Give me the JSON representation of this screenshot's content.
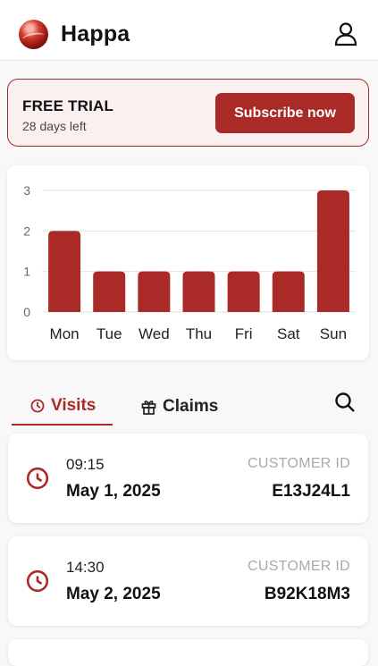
{
  "header": {
    "app_title": "Happa",
    "logo_icon": "happa-logo-icon",
    "profile_icon": "user-profile-icon"
  },
  "trial": {
    "title": "FREE TRIAL",
    "days_left": "28 days left",
    "subscribe_label": "Subscribe now"
  },
  "chart_data": {
    "type": "bar",
    "categories": [
      "Mon",
      "Tue",
      "Wed",
      "Thu",
      "Fri",
      "Sat",
      "Sun"
    ],
    "values": [
      2,
      1,
      1,
      1,
      1,
      1,
      3
    ],
    "ylim": [
      0,
      3
    ],
    "yticks": [
      0,
      1,
      2,
      3
    ],
    "grid": true,
    "bar_color": "#aa2a28"
  },
  "tabs": [
    {
      "label": "Visits",
      "icon": "clock-icon",
      "active": true
    },
    {
      "label": "Claims",
      "icon": "gift-icon",
      "active": false
    }
  ],
  "search_icon": "search-icon",
  "visits": [
    {
      "time": "09:15",
      "date": "May 1, 2025",
      "customer_label": "CUSTOMER ID",
      "customer_id": "E13J24L1"
    },
    {
      "time": "14:30",
      "date": "May 2, 2025",
      "customer_label": "CUSTOMER ID",
      "customer_id": "B92K18M3"
    }
  ],
  "colors": {
    "accent": "#aa2a28",
    "trial_background": "#fbf0f0",
    "muted": "#aaa"
  }
}
